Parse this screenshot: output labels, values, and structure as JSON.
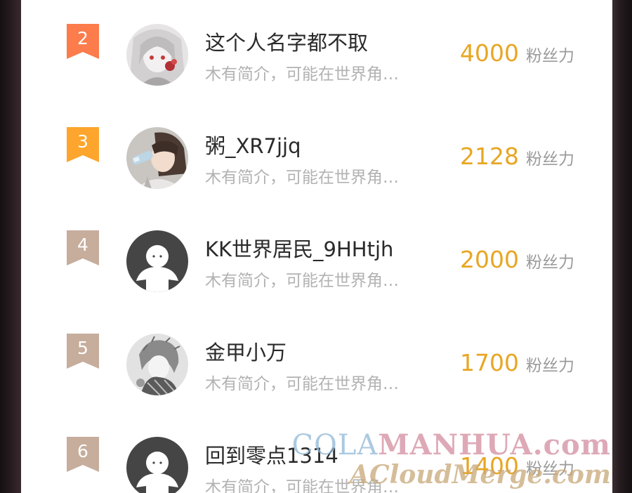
{
  "ranking": {
    "items": [
      {
        "rank": "2",
        "name": "这个人名字都不取",
        "bio": "木有简介，可能在世界角…",
        "score": "4000",
        "score_unit": "粉丝力",
        "badge_color": "#fc7c4c",
        "avatar": "anime-avatar-white-hair"
      },
      {
        "rank": "3",
        "name": "粥_XR7jjq",
        "bio": "木有简介，可能在世界角…",
        "score": "2128",
        "score_unit": "粉丝力",
        "badge_color": "#fda52d",
        "avatar": "anime-avatar-drinking"
      },
      {
        "rank": "4",
        "name": "KK世界居民_9HHtjh",
        "bio": "木有简介，可能在世界角…",
        "score": "2000",
        "score_unit": "粉丝力",
        "badge_color": "#c6ad9c",
        "avatar": "default-avatar"
      },
      {
        "rank": "5",
        "name": "金甲小万",
        "bio": "木有简介，可能在世界角…",
        "score": "1700",
        "score_unit": "粉丝力",
        "badge_color": "#c6ad9c",
        "avatar": "sketch-avatar"
      },
      {
        "rank": "6",
        "name": "回到零点1314",
        "bio": "木有简介，可能在世界角…",
        "score": "1400",
        "score_unit": "粉丝力",
        "badge_color": "#c6ad9c",
        "avatar": "default-avatar"
      }
    ]
  },
  "watermark": {
    "line1_part1": "COLA",
    "line1_part2": "MANHUA.com",
    "line2": "ACloudMerge.com"
  }
}
